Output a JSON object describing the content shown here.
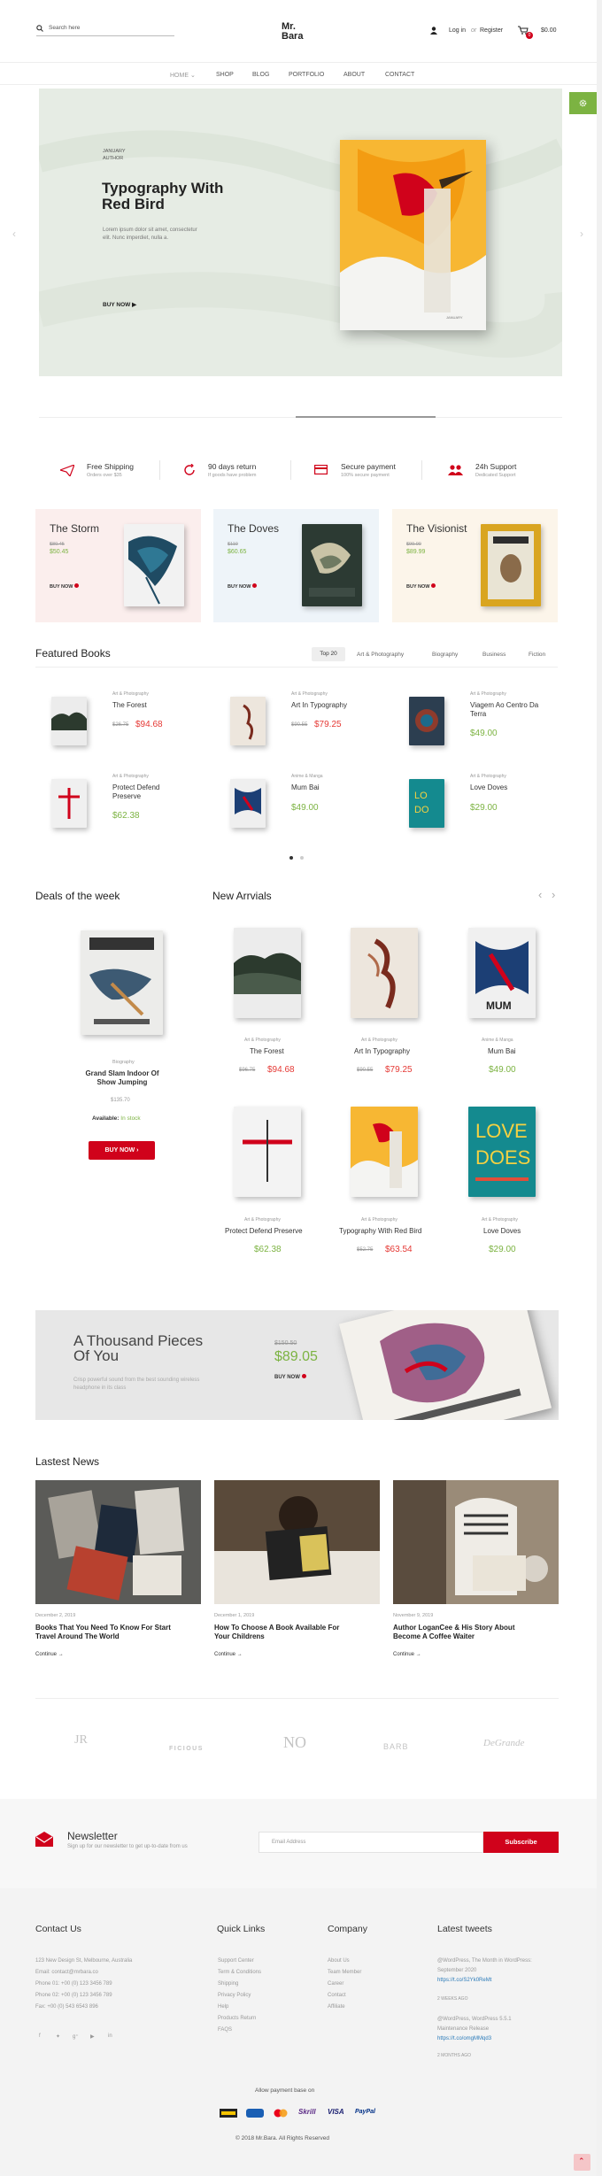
{
  "header": {
    "search_placeholder": "Search here",
    "logo_line1": "Mr.",
    "logo_line2": "Bara",
    "login": "Log in",
    "or": "or",
    "register": "Register",
    "cart_count": "0",
    "cart_total": "$0.00"
  },
  "nav": [
    {
      "label": "HOME"
    },
    {
      "label": "SHOP"
    },
    {
      "label": "BLOG"
    },
    {
      "label": "PORTFOLIO"
    },
    {
      "label": "ABOUT"
    },
    {
      "label": "CONTACT"
    }
  ],
  "hero": {
    "eyebrow1": "JANUARY",
    "eyebrow2": "AUTHOR",
    "title1": "Typography With",
    "title2": "Red Bird",
    "desc1": "Lorem ipsum dolor sit amet, consectetur",
    "desc2": "elit. Nunc imperdiet, nulla a.",
    "cta": "BUY NOW",
    "book_label": "JANUARY"
  },
  "features": [
    {
      "title": "Free Shipping",
      "sub": "Orders over $35"
    },
    {
      "title": "90 days return",
      "sub": "If goods have problem"
    },
    {
      "title": "Secure payment",
      "sub": "100% secure payment"
    },
    {
      "title": "24h Support",
      "sub": "Dedicated Support"
    }
  ],
  "promos": [
    {
      "title": "The Storm",
      "old": "$80.45",
      "price": "$50.45",
      "cta": "BUY NOW"
    },
    {
      "title": "The Doves",
      "old": "$110",
      "price": "$60.65",
      "cta": "BUY NOW"
    },
    {
      "title": "The Visionist",
      "old": "$99.00",
      "price": "$89.99",
      "cta": "BUY NOW"
    }
  ],
  "featured": {
    "heading": "Featured Books",
    "tabs": [
      "Top 20",
      "Art & Photography",
      "Biography",
      "Business",
      "Fiction"
    ],
    "items": [
      {
        "cat": "Art & Photography",
        "name": "The Forest",
        "old": "$26.75",
        "price": "$94.68"
      },
      {
        "cat": "Art & Photography",
        "name": "Art In Typography",
        "old": "$90.55",
        "price": "$79.25"
      },
      {
        "cat": "Art & Photography",
        "name": "Viagem Ao Centro Da Terra",
        "old": "",
        "price": "$49.00"
      },
      {
        "cat": "Art & Photography",
        "name": "Protect Defend Preserve",
        "old": "",
        "price": "$62.38"
      },
      {
        "cat": "Anime & Manga",
        "name": "Mum Bai",
        "old": "",
        "price": "$49.00"
      },
      {
        "cat": "Art & Photography",
        "name": "Love Doves",
        "old": "",
        "price": "$29.00"
      }
    ]
  },
  "deals": {
    "heading": "Deals of the week",
    "cat": "Biography",
    "name1": "Grand Slam Indoor Of",
    "name2": "Show Jumping",
    "price": "$135.70",
    "avail_label": "Available:",
    "avail_value": "In stock",
    "cta": "BUY NOW"
  },
  "arrivals": {
    "heading": "New Arrvials",
    "items": [
      {
        "cat": "Art & Photography",
        "name": "The Forest",
        "old": "$96.75",
        "price": "$94.68"
      },
      {
        "cat": "Art & Photography",
        "name": "Art In Typography",
        "old": "$90.55",
        "price": "$79.25"
      },
      {
        "cat": "Anime & Manga",
        "name": "Mum Bai",
        "old": "",
        "price": "$49.00"
      },
      {
        "cat": "Art & Photography",
        "name": "Protect Defend Preserve",
        "old": "",
        "price": "$62.38"
      },
      {
        "cat": "Art & Photography",
        "name": "Typography With Red Bird",
        "old": "$52.75",
        "price": "$63.54"
      },
      {
        "cat": "Art & Photography",
        "name": "Love Doves",
        "old": "",
        "price": "$29.00"
      }
    ]
  },
  "banner": {
    "title1": "A Thousand Pieces",
    "title2": "Of You",
    "desc1": "Crisp powerful sound from the best sounding wireless",
    "desc2": "headphone in its class",
    "old": "$150.50",
    "price": "$89.05",
    "cta": "BUY NOW"
  },
  "news": {
    "heading": "Lastest News",
    "items": [
      {
        "date": "December 2, 2019",
        "title1": "Books That You Need To Know For Start",
        "title2": "Travel Around The World",
        "more": "Continue"
      },
      {
        "date": "December 1, 2019",
        "title1": "How To Choose A Book Available For",
        "title2": "Your Childrens",
        "more": "Continue"
      },
      {
        "date": "November 9, 2019",
        "title1": "Author LoganCee & His Story About",
        "title2": "Become A Coffee Waiter",
        "more": "Continue"
      }
    ]
  },
  "brands": [
    "JR",
    "FICIOUS",
    "NO",
    "BARB",
    "DeGrande"
  ],
  "newsletter": {
    "title": "Newsletter",
    "sub": "Sign up for our newsletter to get up-to-date from us",
    "placeholder": "Email Address",
    "button": "Subscribe"
  },
  "footer": {
    "contact_h": "Contact Us",
    "address": "123 New Design St, Melbourne, Australia",
    "email": "Email: contact@mrbara.co",
    "phone1": "Phone 01: +00 (0) 123 3456 789",
    "phone2": "Phone 02: +00 (0) 123 3456 789",
    "fax": "Fax: +00 (0) 543 6543 896",
    "quick_h": "Quick Links",
    "quick": [
      "Support Center",
      "Term & Conditions",
      "Shipping",
      "Privacy Policy",
      "Help",
      "Products Return",
      "FAQS"
    ],
    "company_h": "Company",
    "company": [
      "About Us",
      "Team Member",
      "Career",
      "Contact",
      "Affiliate"
    ],
    "tweets_h": "Latest tweets",
    "t1a": "@WordPress, The Month in WordPress:",
    "t1b": "September 2020",
    "t1c": "https://t.co/S2Yk0ReMt",
    "t1d": "2 WEEKS AGO",
    "t2a": "@WordPress, WordPress 5.5.1",
    "t2b": "Maintenance Release",
    "t2c": "https://t.co/omgMMqd3",
    "t2d": "2 MONTHS AGO",
    "payment_label": "Allow payment base on",
    "payments": [
      "VISA",
      "PayPal"
    ],
    "copyright": "© 2018 Mr.Bara. All Rights Reserved"
  },
  "colors": {
    "accent": "#d0021b",
    "green": "#7cb342",
    "price_red": "#e53935",
    "hero_bg": "#e6ece4"
  }
}
